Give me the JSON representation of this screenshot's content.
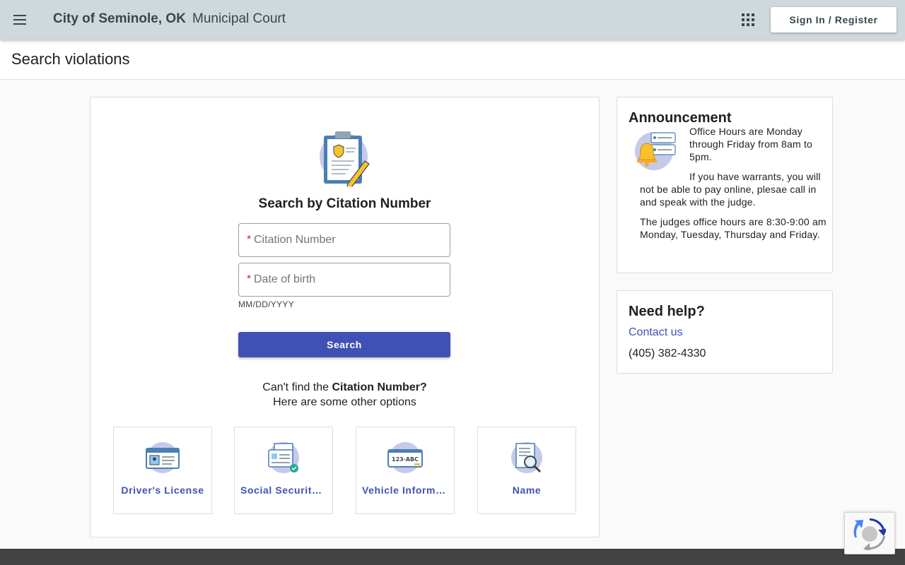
{
  "header": {
    "brand": "City of Seminole, OK",
    "subtitle": "Municipal Court",
    "signin_label": "Sign In / Register",
    "menu_icon": "menu-icon",
    "apps_icon": "apps-grid-icon"
  },
  "page": {
    "title": "Search violations"
  },
  "search": {
    "heading": "Search by Citation Number",
    "citation_placeholder": "Citation Number",
    "dob_placeholder": "Date of birth",
    "required_marker": "*",
    "dob_hint": "MM/DD/YYYY",
    "button_label": "Search",
    "cant_find_prefix": "Can't find the",
    "cant_find_bold": "Citation Number?",
    "cant_find_line2": "Here are some other options"
  },
  "options": [
    {
      "label": "Driver's License",
      "icon": "drivers-license-icon"
    },
    {
      "label": "Social Security Number",
      "icon": "social-security-icon"
    },
    {
      "label": "Vehicle Information",
      "icon": "vehicle-plate-icon"
    },
    {
      "label": "Name",
      "icon": "name-search-icon"
    }
  ],
  "announcement": {
    "title": "Announcement",
    "p1": "Office Hours are Monday through Friday from 8am to 5pm.",
    "p2": "If you have warrants, you will not be able to pay online, plesae call in and speak with the judge.",
    "p3": "The judges office hours are 8:30-9:00 am Monday, Tuesday, Thursday and Friday."
  },
  "help": {
    "title": "Need help?",
    "contact_label": "Contact us",
    "phone": "(405) 382-4330"
  },
  "colors": {
    "header_bg": "#cfd8dc",
    "primary": "#3f51b5",
    "footer": "#424242"
  }
}
